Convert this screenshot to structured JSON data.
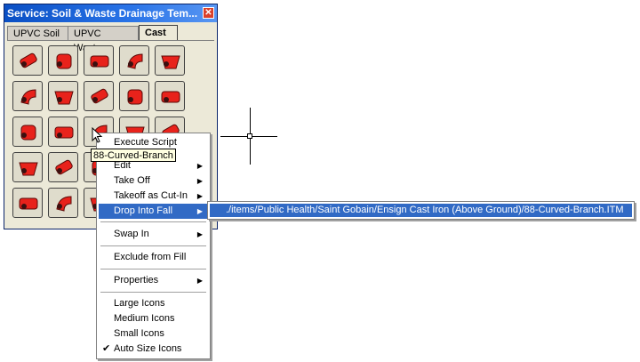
{
  "window": {
    "title": "Service: Soil & Waste Drainage   Tem...",
    "close_glyph": "✕"
  },
  "tabs": [
    {
      "label": "UPVC Soil",
      "active": false
    },
    {
      "label": "UPVC Waste",
      "active": false
    },
    {
      "label": "Cast",
      "active": true
    }
  ],
  "palette": {
    "fitting_color": "#e8221b",
    "items": [
      "fitting-icon",
      "fitting-icon",
      "fitting-icon",
      "fitting-icon",
      "fitting-icon",
      "fitting-icon",
      "fitting-icon",
      "fitting-icon",
      "fitting-icon",
      "fitting-icon",
      "fitting-icon",
      "fitting-icon",
      "fitting-icon",
      "fitting-icon",
      "fitting-icon",
      "fitting-icon",
      "fitting-icon",
      "fitting-icon",
      "fitting-icon",
      "fitting-icon",
      "fitting-icon",
      "fitting-icon",
      "fitting-icon",
      "fitting-icon",
      "fitting-icon"
    ]
  },
  "tooltip": "88-Curved-Branch",
  "context_menu": {
    "items": [
      {
        "label": "Execute Script",
        "submenu": false
      },
      {
        "label": "Edit",
        "submenu": true
      },
      {
        "label": "Take Off",
        "submenu": true
      },
      {
        "label": "Takeoff as Cut-In",
        "submenu": true
      },
      {
        "label": "Drop Into Fall",
        "submenu": true,
        "selected": true
      },
      {
        "label": "Swap In",
        "submenu": true
      },
      {
        "label": "Exclude from Fill",
        "submenu": false
      },
      {
        "label": "Properties",
        "submenu": true
      },
      {
        "label": "Large Icons",
        "submenu": false
      },
      {
        "label": "Medium Icons",
        "submenu": false
      },
      {
        "label": "Small Icons",
        "submenu": false
      },
      {
        "label": "Auto Size Icons",
        "submenu": false,
        "checked": true
      }
    ],
    "arrow_glyph": "▶",
    "check_glyph": "✔"
  },
  "submenu": {
    "path": "./items/Public Health/Saint Gobain/Ensign Cast Iron (Above Ground)/88-Curved-Branch.ITM"
  },
  "colors": {
    "highlight": "#316ac5",
    "titlebar": "#0a4fc4"
  }
}
